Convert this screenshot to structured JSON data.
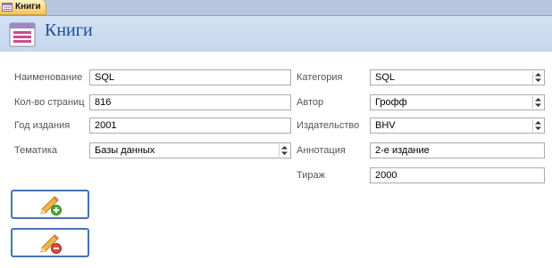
{
  "tab": {
    "label": "Книги"
  },
  "header": {
    "title": "Книги"
  },
  "form": {
    "name_label": "Наименование",
    "name_value": "SQL",
    "pages_label": "Кол-во страниц",
    "pages_value": "816",
    "year_label": "Год издания",
    "year_value": "2001",
    "topic_label": "Тематика",
    "topic_value": "Базы данных",
    "category_label": "Категория",
    "category_value": "SQL",
    "author_label": "Автор",
    "author_value": "Грофф",
    "publisher_label": "Издательство",
    "publisher_value": "BHV",
    "annotation_label": "Аннотация",
    "annotation_value": "2-е издание",
    "circulation_label": "Тираж",
    "circulation_value": "2000"
  },
  "buttons": {
    "add_icon": "pencil-plus-icon",
    "delete_icon": "pencil-minus-icon"
  },
  "colors": {
    "accent": "#4672b3",
    "title": "#1f4e97",
    "tab": "#f7c35a",
    "header": "#c6d7ee"
  }
}
